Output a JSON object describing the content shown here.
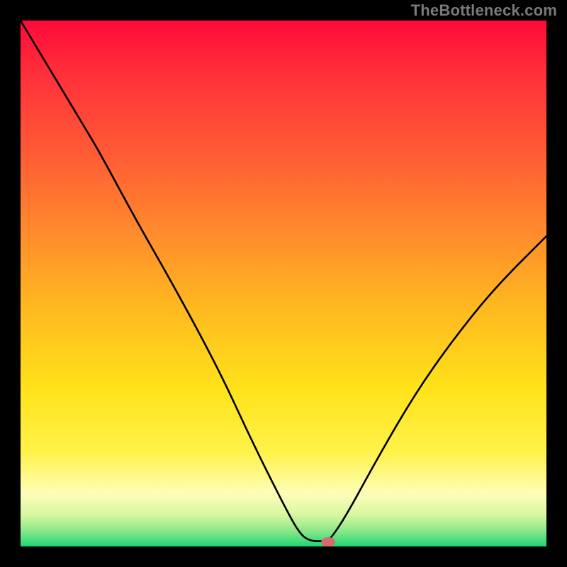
{
  "chart_data": {
    "type": "line",
    "title": "",
    "xlabel": "",
    "ylabel": "",
    "xlim": [
      0,
      100
    ],
    "ylim": [
      0,
      100
    ],
    "curve": [
      {
        "x": 0,
        "y": 100
      },
      {
        "x": 6,
        "y": 90
      },
      {
        "x": 12,
        "y": 80
      },
      {
        "x": 15,
        "y": 75
      },
      {
        "x": 22,
        "y": 62
      },
      {
        "x": 30,
        "y": 48
      },
      {
        "x": 38,
        "y": 33
      },
      {
        "x": 44,
        "y": 20
      },
      {
        "x": 50,
        "y": 8
      },
      {
        "x": 53,
        "y": 2.5
      },
      {
        "x": 55,
        "y": 1
      },
      {
        "x": 58,
        "y": 1
      },
      {
        "x": 59,
        "y": 1.5
      },
      {
        "x": 62,
        "y": 6
      },
      {
        "x": 68,
        "y": 17
      },
      {
        "x": 75,
        "y": 29
      },
      {
        "x": 82,
        "y": 39
      },
      {
        "x": 90,
        "y": 49
      },
      {
        "x": 100,
        "y": 59
      }
    ],
    "marker": {
      "x": 58.5,
      "y": 0.8,
      "rx": 1.35,
      "ry": 0.95
    },
    "gradient_stops": [
      {
        "offset": 0.0,
        "color": "#ff0a3a"
      },
      {
        "offset": 0.1,
        "color": "#ff2f3a"
      },
      {
        "offset": 0.25,
        "color": "#ff5a35"
      },
      {
        "offset": 0.4,
        "color": "#ff8a2d"
      },
      {
        "offset": 0.55,
        "color": "#ffba20"
      },
      {
        "offset": 0.7,
        "color": "#ffe21a"
      },
      {
        "offset": 0.82,
        "color": "#fff24a"
      },
      {
        "offset": 0.9,
        "color": "#fdfdb8"
      },
      {
        "offset": 0.94,
        "color": "#d8f7a0"
      },
      {
        "offset": 0.97,
        "color": "#8be88a"
      },
      {
        "offset": 1.0,
        "color": "#1fd673"
      }
    ]
  },
  "watermark": "TheBottleneck.com",
  "colors": {
    "curve": "#000000",
    "marker": "#d56a6f",
    "plot_border": "#000000",
    "page_bg": "#000000"
  }
}
